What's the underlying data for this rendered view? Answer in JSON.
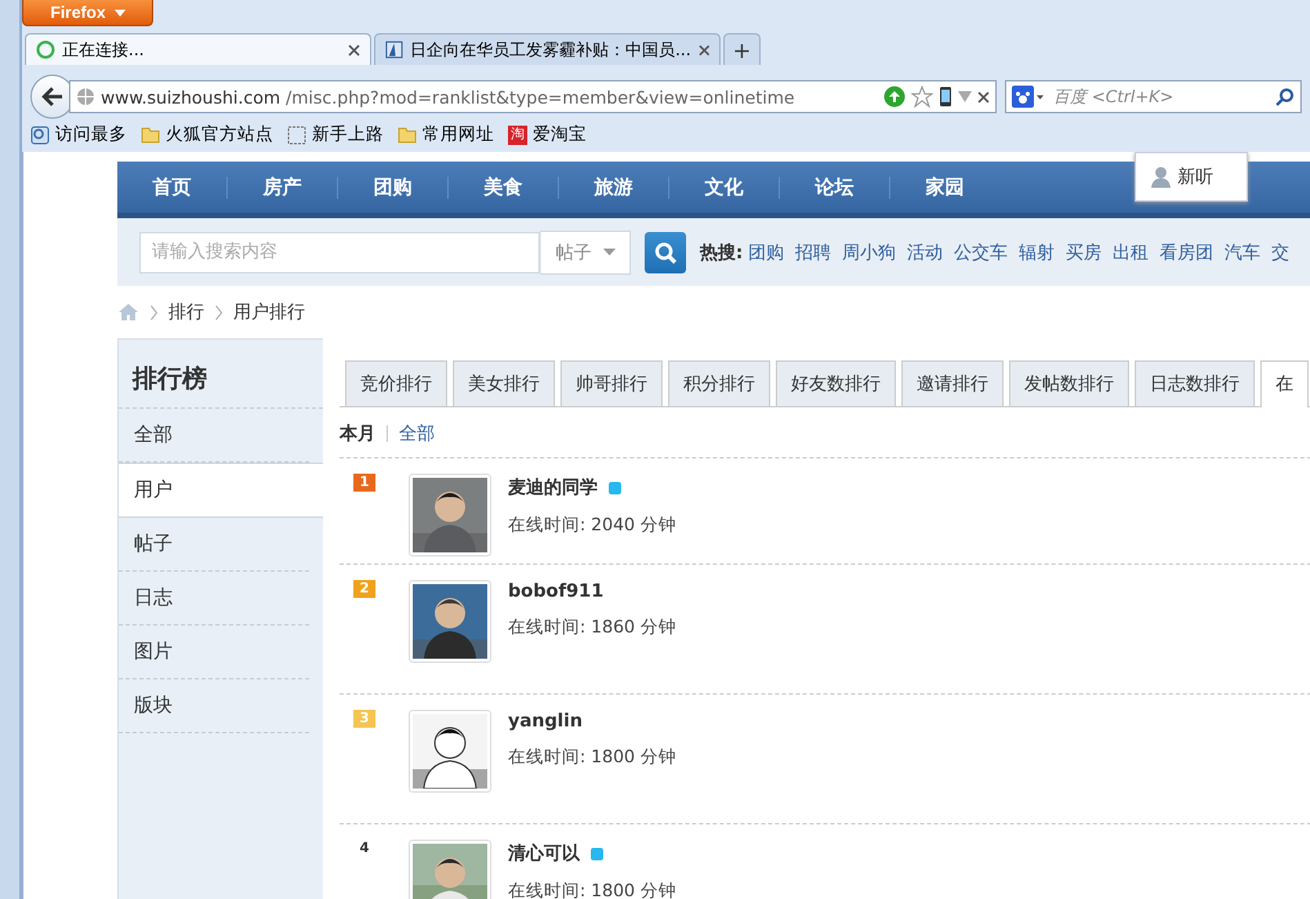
{
  "browser": {
    "menu_button": "Firefox",
    "tabs": [
      {
        "title": "正在连接...",
        "selected": true,
        "loading": true
      },
      {
        "title": "日企向在华员工发雾霾补贴：中国员...",
        "selected": false,
        "loading": false
      }
    ],
    "new_tab": "+",
    "url": {
      "host": "www.suizhoushi.com",
      "path": "/misc.php?mod=ranklist&type=member&view=onlinetime"
    },
    "search_placeholder": "百度 <Ctrl+K>",
    "bookmarks": [
      {
        "label": "访问最多",
        "kind": "feed"
      },
      {
        "label": "火狐官方站点",
        "kind": "folder"
      },
      {
        "label": "新手上路",
        "kind": "page"
      },
      {
        "label": "常用网址",
        "kind": "folder"
      },
      {
        "label": "爱淘宝",
        "kind": "badge",
        "icon_text": "淘"
      }
    ]
  },
  "site": {
    "nav": [
      "首页",
      "房产",
      "团购",
      "美食",
      "旅游",
      "文化",
      "论坛",
      "家园"
    ],
    "user_menu": "新听",
    "search": {
      "placeholder": "请输入搜索内容",
      "scope": "帖子"
    },
    "hot_label": "热搜:",
    "hot": [
      "团购",
      "招聘",
      "周小狗",
      "活动",
      "公交车",
      "辐射",
      "买房",
      "出租",
      "看房团",
      "汽车",
      "交"
    ],
    "breadcrumb": [
      "排行",
      "用户排行"
    ]
  },
  "sidebar": {
    "title": "排行榜",
    "items": [
      {
        "label": "全部",
        "selected": false
      },
      {
        "label": "用户",
        "selected": true
      },
      {
        "label": "帖子",
        "selected": false
      },
      {
        "label": "日志",
        "selected": false
      },
      {
        "label": "图片",
        "selected": false
      },
      {
        "label": "版块",
        "selected": false
      }
    ]
  },
  "tabs": [
    {
      "label": "竞价排行",
      "selected": false
    },
    {
      "label": "美女排行",
      "selected": false
    },
    {
      "label": "帅哥排行",
      "selected": false
    },
    {
      "label": "积分排行",
      "selected": false
    },
    {
      "label": "好友数排行",
      "selected": false
    },
    {
      "label": "邀请排行",
      "selected": false
    },
    {
      "label": "发帖数排行",
      "selected": false
    },
    {
      "label": "日志数排行",
      "selected": false
    },
    {
      "label": "在",
      "selected": true
    }
  ],
  "periods": [
    {
      "label": "本月",
      "selected": true
    },
    {
      "label": "全部",
      "selected": false
    }
  ],
  "users": [
    {
      "rank": "1",
      "color": "#e8691c",
      "name": "麦迪的同学",
      "online": true,
      "time": "在线时间: 2040 分钟"
    },
    {
      "rank": "2",
      "color": "#f0a21e",
      "name": "bobof911",
      "online": false,
      "time": "在线时间: 1860 分钟"
    },
    {
      "rank": "3",
      "color": "#f5c451",
      "name": "yanglin",
      "online": false,
      "time": "在线时间: 1800 分钟"
    },
    {
      "rank": "4",
      "name": "清心可以",
      "online": true,
      "time": "在线时间: 1800 分钟"
    }
  ]
}
